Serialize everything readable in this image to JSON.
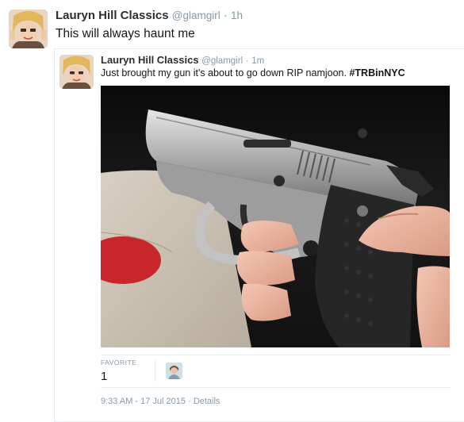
{
  "outer_tweet": {
    "name": "Lauryn Hill Classics",
    "handle": "@glamgirl",
    "separator": "·",
    "time": "1h",
    "text": "This will always haunt me"
  },
  "quoted_tweet": {
    "name": "Lauryn Hill Classics",
    "handle": "@glamgirl",
    "separator": "·",
    "time": "1m",
    "text": "Just brought my gun it's about to go down RIP namjoon. ",
    "hashtag": "#TRBinNYC"
  },
  "stats": {
    "favorite_label": "FAVORITE",
    "favorite_count": "1"
  },
  "meta": {
    "timestamp": "9:33 AM - 17 Jul 2015",
    "separator": "·",
    "details_link": "Details"
  },
  "icons": {
    "outer_avatar": "profile-photo",
    "quoted_avatar": "profile-photo",
    "favoriter_avatar": "profile-photo",
    "media": "photo-handgun"
  },
  "colors": {
    "text": "#292f33",
    "muted": "#8899a6",
    "border": "#e6ecf0"
  }
}
